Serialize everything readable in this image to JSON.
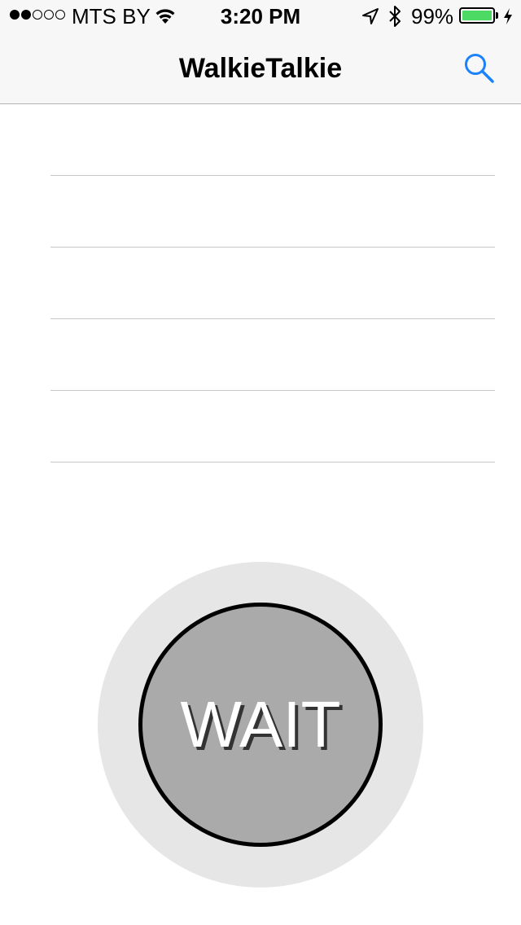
{
  "status_bar": {
    "signal_filled": 2,
    "signal_total": 5,
    "carrier": "MTS BY",
    "wifi_icon": "wifi-icon",
    "time": "3:20 PM",
    "location_icon": "location-arrow-icon",
    "bluetooth_icon": "bluetooth-icon",
    "battery_percent": "99%",
    "battery_level": 0.99,
    "battery_color": "#4cd964",
    "charging_icon": "charging-bolt-icon"
  },
  "nav_bar": {
    "title": "WalkieTalkie",
    "search_icon": "search-icon",
    "accent_color": "#1a82fb"
  },
  "list": {
    "rows": [
      "",
      "",
      "",
      "",
      ""
    ]
  },
  "talk_button": {
    "label": "WAIT",
    "fill_color": "#aaaaaa",
    "ring_color": "#e6e6e6"
  }
}
